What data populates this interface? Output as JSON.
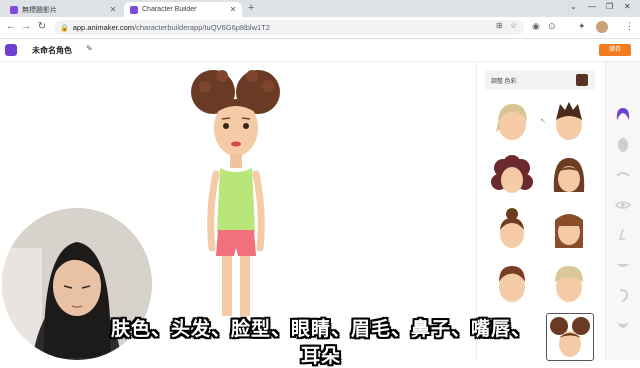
{
  "browser": {
    "tabs": [
      {
        "title": "無標題影片",
        "active": false
      },
      {
        "title": "Character Builder",
        "active": true
      }
    ],
    "url_domain": "app.animaker.com",
    "url_path": "/characterbuilderapp/tuQV6G6p8lblw1T2"
  },
  "app": {
    "project_name": "未命名角色",
    "save_label": "储存",
    "accent_color": "#f07d24",
    "logo_color": "#6c3fd1"
  },
  "panel": {
    "color_label": "調整 色彩",
    "selected_color": "#5a3324",
    "hair_styles": [
      "short-blonde",
      "spiky-dark",
      "curly-auburn",
      "wavy-brown",
      "top-bun",
      "long-straight-brown",
      "short-brown",
      "short-blonde-2",
      "twin-puff-buns"
    ]
  },
  "rail_icons": [
    "hair-icon",
    "face-shape-icon",
    "eyebrow-icon",
    "eye-icon",
    "nose-icon",
    "mouth-icon",
    "ear-icon",
    "beard-icon"
  ],
  "subtitle": "肤色、头发、脸型、眼睛、眉毛、鼻子、嘴唇、耳朵"
}
